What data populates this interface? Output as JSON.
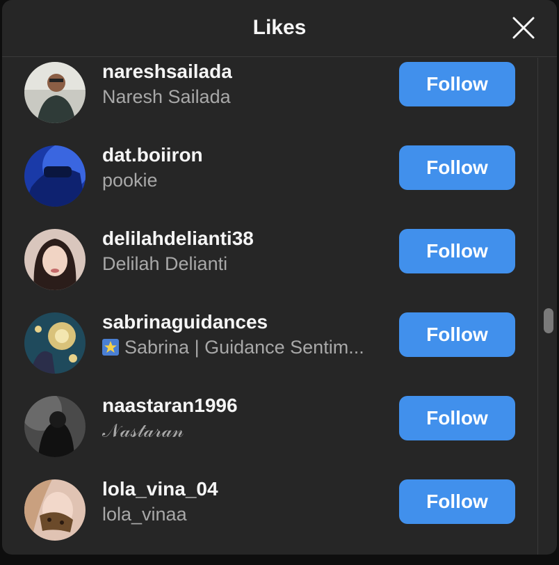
{
  "dialog": {
    "title": "Likes",
    "close_icon": "close-icon"
  },
  "users": [
    {
      "username": "nareshsailada",
      "full_name": "Naresh Sailada",
      "button": "Follow"
    },
    {
      "username": "dat.boiiron",
      "full_name": "pookie",
      "button": "Follow"
    },
    {
      "username": "delilahdelianti38",
      "full_name": "Delilah Delianti",
      "button": "Follow"
    },
    {
      "username": "sabrinaguidances",
      "full_name": "Sabrina | Guidance Sentim...",
      "full_name_emoji": "star-emoji-icon",
      "button": "Follow"
    },
    {
      "username": "naastaran1996",
      "full_name": "𝒩𝒶𝓈𝓉𝒶𝓇𝒶𝓃",
      "button": "Follow"
    },
    {
      "username": "lola_vina_04",
      "full_name": "lola_vinaa",
      "button": "Follow"
    }
  ],
  "colors": {
    "modal_bg": "#262626",
    "button_bg": "#4190ec",
    "username": "#f5f5f5",
    "full_name": "#a8a8a8"
  }
}
